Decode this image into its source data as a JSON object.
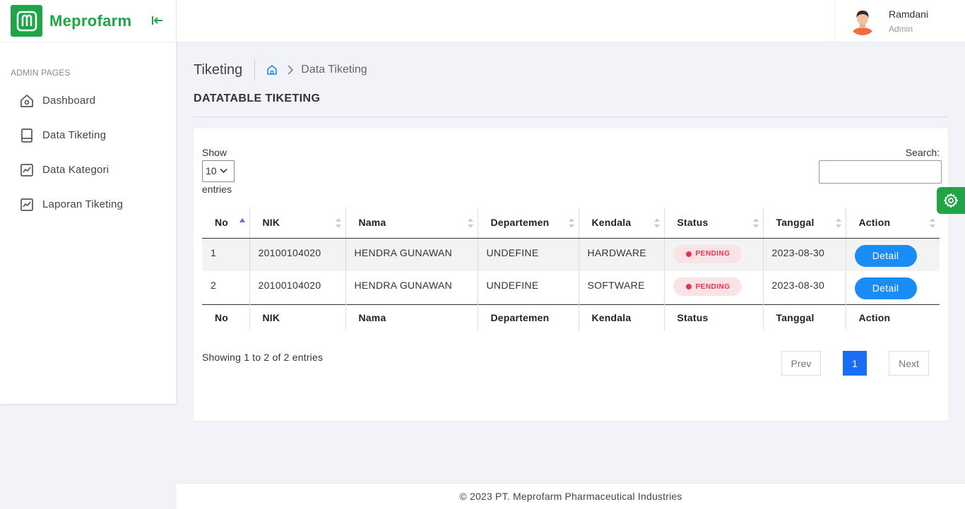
{
  "brand": {
    "name": "Meprofarm",
    "color": "#1fa548"
  },
  "sidebar": {
    "caption": "ADMIN PAGES",
    "items": [
      {
        "label": "Dashboard",
        "icon": "home-icon"
      },
      {
        "label": "Data Tiketing",
        "icon": "book-icon"
      },
      {
        "label": "Data Kategori",
        "icon": "chart-line-icon"
      },
      {
        "label": "Laporan Tiketing",
        "icon": "chart-line-icon"
      }
    ]
  },
  "user": {
    "name": "Ramdani",
    "role": "Admin"
  },
  "page": {
    "title": "Tiketing",
    "breadcrumb": "Data Tiketing",
    "section_title": "DATATABLE TIKETING"
  },
  "table_controls": {
    "show_label": "Show",
    "page_size": "10",
    "entries_label": "entries",
    "search_label": "Search:",
    "search_value": ""
  },
  "table": {
    "columns": [
      "No",
      "NIK",
      "Nama",
      "Departemen",
      "Kendala",
      "Status",
      "Tanggal",
      "Action"
    ],
    "rows": [
      {
        "no": "1",
        "nik": "20100104020",
        "nama": "HENDRA GUNAWAN",
        "departemen": "UNDEFINE",
        "kendala": "HARDWARE",
        "status": "PENDING",
        "tanggal": "2023-08-30",
        "action": "Detail"
      },
      {
        "no": "2",
        "nik": "20100104020",
        "nama": "HENDRA GUNAWAN",
        "departemen": "UNDEFINE",
        "kendala": "SOFTWARE",
        "status": "PENDING",
        "tanggal": "2023-08-30",
        "action": "Detail"
      }
    ]
  },
  "pagination": {
    "info": "Showing 1 to 2 of 2 entries",
    "prev": "Prev",
    "current": "1",
    "next": "Next"
  },
  "footer": {
    "text": "© 2023 PT. Meprofarm Pharmaceutical Industries"
  },
  "colors": {
    "accent": "#1fa548",
    "primary": "#1a8cf5",
    "pending": "#e8334f"
  }
}
